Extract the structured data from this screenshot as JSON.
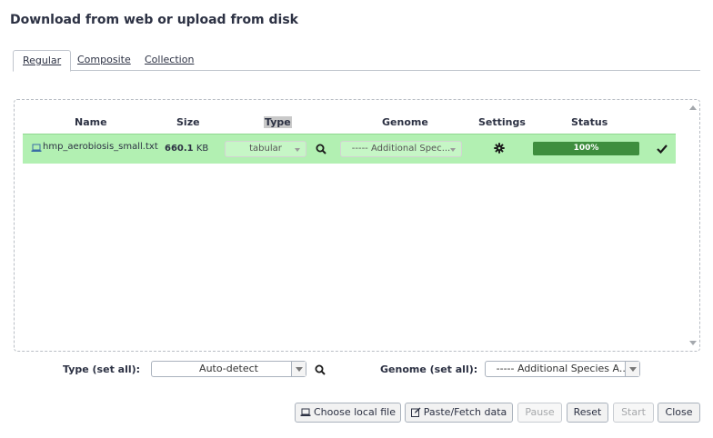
{
  "dialog": {
    "title": "Download from web or upload from disk"
  },
  "tabs": [
    {
      "label": "Regular",
      "active": true
    },
    {
      "label": "Composite",
      "active": false
    },
    {
      "label": "Collection",
      "active": false
    }
  ],
  "table": {
    "headers": {
      "name": "Name",
      "size": "Size",
      "type": "Type",
      "genome": "Genome",
      "settings": "Settings",
      "status": "Status"
    },
    "rows": [
      {
        "name": "hmp_aerobiosis_small.txt",
        "size_value": "660.1",
        "size_unit": "KB",
        "type": "tabular",
        "genome": "----- Additional Spec...",
        "status_percent": 100,
        "status_label": "100%",
        "row_color": "#b2f0b2"
      }
    ]
  },
  "set_all": {
    "type_label": "Type (set all):",
    "type_value": "Auto-detect",
    "genome_label": "Genome (set all):",
    "genome_value": "----- Additional Species A..."
  },
  "buttons": {
    "choose_local": "Choose local file",
    "paste_fetch": "Paste/Fetch data",
    "pause": "Pause",
    "reset": "Reset",
    "start": "Start",
    "close": "Close"
  },
  "colors": {
    "success_row": "#b2f0b2",
    "progress": "#3b8f3b"
  }
}
